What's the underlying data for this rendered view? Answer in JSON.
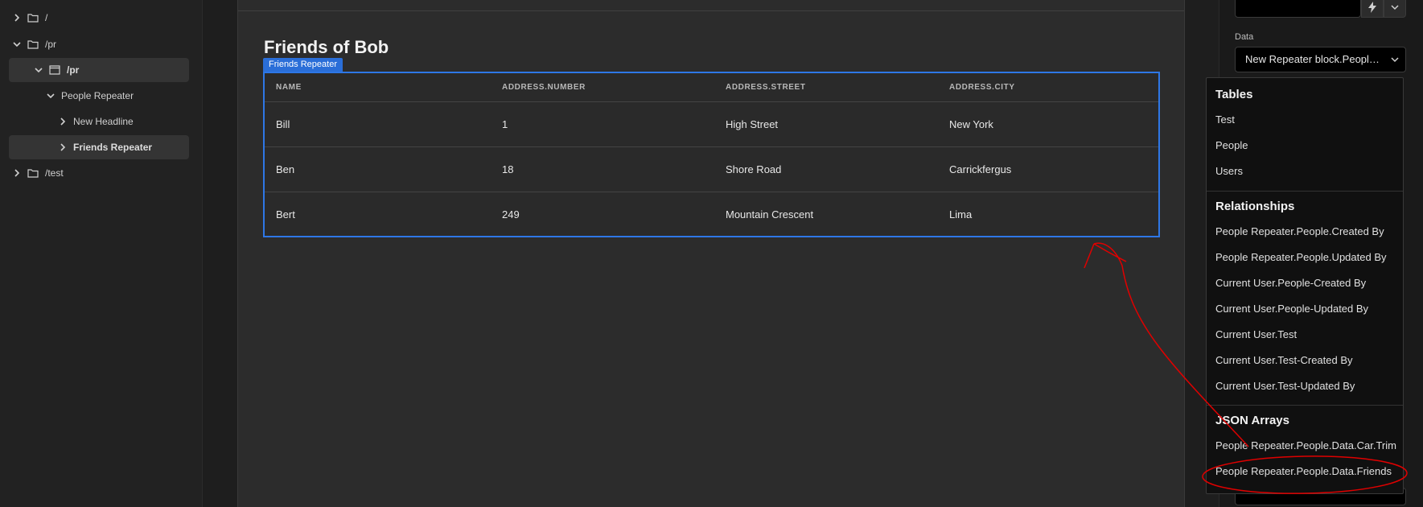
{
  "nav": {
    "items": [
      {
        "label": "/",
        "level": 0,
        "expanded": false,
        "folder": true
      },
      {
        "label": "/pr",
        "level": 0,
        "expanded": true,
        "folder": true
      },
      {
        "label": "/pr",
        "level": 1,
        "expanded": true,
        "folder": true,
        "selected": true
      },
      {
        "label": "People Repeater",
        "level": 2,
        "expanded": true
      },
      {
        "label": "New Headline",
        "level": 3,
        "expanded": false
      },
      {
        "label": "Friends Repeater",
        "level": 3,
        "expanded": false,
        "selected": true
      },
      {
        "label": "/test",
        "level": 0,
        "expanded": false,
        "folder": true
      }
    ]
  },
  "canvas": {
    "heading": "Friends of Bob",
    "repeater_tag": "Friends Repeater",
    "table": {
      "columns": [
        "NAME",
        "ADDRESS.NUMBER",
        "ADDRESS.STREET",
        "ADDRESS.CITY"
      ],
      "rows": [
        [
          "Bill",
          "1",
          "High Street",
          "New York"
        ],
        [
          "Ben",
          "18",
          "Shore Road",
          "Carrickfergus"
        ],
        [
          "Bert",
          "249",
          "Mountain Crescent",
          "Lima"
        ]
      ]
    }
  },
  "panel": {
    "data_label": "Data",
    "data_value": "New Repeater block.Peopl…",
    "bolt_icon": "lightning-icon",
    "chevron_icon": "chevron-down-icon"
  },
  "menu": {
    "sections": [
      {
        "title": "Tables",
        "items": [
          "Test",
          "People",
          "Users"
        ]
      },
      {
        "title": "Relationships",
        "items": [
          "People Repeater.People.Created By",
          "People Repeater.People.Updated By",
          "Current User.People-Created By",
          "Current User.People-Updated By",
          "Current User.Test",
          "Current User.Test-Created By",
          "Current User.Test-Updated By"
        ]
      },
      {
        "title": "JSON Arrays",
        "items": [
          "People Repeater.People.Data.Car.Trim",
          "People Repeater.People.Data.Friends"
        ]
      }
    ]
  },
  "colors": {
    "accent": "#2e77e6",
    "annotation": "#e00000"
  }
}
